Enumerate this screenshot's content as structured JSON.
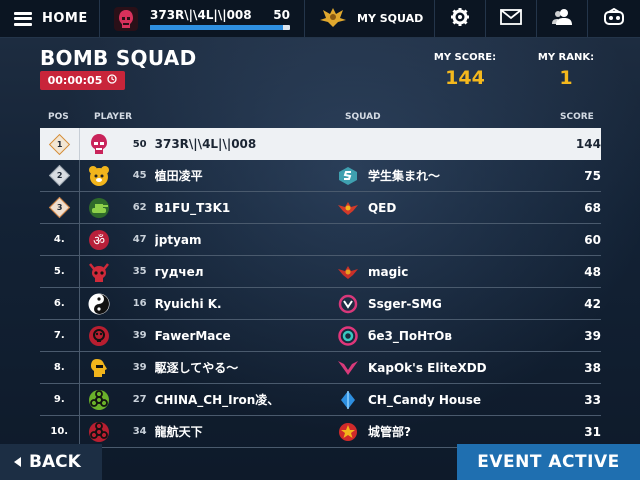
{
  "topbar": {
    "home_label": "HOME",
    "player_name": "373R\\|\\4L|\\|008",
    "player_level": "50",
    "xp_progress_percent": 95,
    "squad_label": "MY SQUAD"
  },
  "event": {
    "title": "BOMB SQUAD",
    "timer": "00:00:05"
  },
  "stats": {
    "my_score_label": "MY SCORE:",
    "my_score": "144",
    "my_rank_label": "MY RANK:",
    "my_rank": "1"
  },
  "columns": {
    "pos": "POS",
    "player": "PLAYER",
    "squad": "SQUAD",
    "score": "SCORE"
  },
  "rows": [
    {
      "pos": "1",
      "pos_style": "gold",
      "level": "50",
      "player": "373R\\|\\4L|\\|008",
      "squad": "",
      "score": "144",
      "avatar_icon": "skull-mask-icon",
      "squad_icon": ""
    },
    {
      "pos": "2",
      "pos_style": "silver",
      "level": "45",
      "player": "植田凌平",
      "squad": "学生集まれ〜",
      "score": "75",
      "avatar_icon": "bear-face-icon",
      "squad_icon": "s-shield-emblem-icon"
    },
    {
      "pos": "3",
      "pos_style": "bronze",
      "level": "62",
      "player": "B1FU_T3K1",
      "squad": "QED",
      "score": "68",
      "avatar_icon": "tank-icon",
      "squad_icon": "winged-emblem-icon"
    },
    {
      "pos": "4.",
      "pos_style": "plain",
      "level": "47",
      "player": "jptyam",
      "squad": "",
      "score": "60",
      "avatar_icon": "om-symbol-icon",
      "squad_icon": ""
    },
    {
      "pos": "5.",
      "pos_style": "plain",
      "level": "35",
      "player": "гудчел",
      "squad": "magic",
      "score": "48",
      "avatar_icon": "horned-skull-icon",
      "squad_icon": "winged-emblem-icon"
    },
    {
      "pos": "6.",
      "pos_style": "plain",
      "level": "16",
      "player": "Ryuichi K.",
      "squad": "Ssger-SMG",
      "score": "42",
      "avatar_icon": "yin-yang-icon",
      "squad_icon": "ring-emblem-icon"
    },
    {
      "pos": "7.",
      "pos_style": "plain",
      "level": "39",
      "player": "FawerMace",
      "squad": "бе3_ПоНтОв",
      "score": "39",
      "avatar_icon": "biohazard-skull-icon",
      "squad_icon": "pink-ring-emblem-icon"
    },
    {
      "pos": "8.",
      "pos_style": "plain",
      "level": "39",
      "player": "駆逐してやる〜",
      "squad": "KapOk's EliteXDD",
      "score": "38",
      "avatar_icon": "profile-head-icon",
      "squad_icon": "v-wings-emblem-icon"
    },
    {
      "pos": "9.",
      "pos_style": "plain",
      "level": "27",
      "player": "CHINA_CH_Iron凌、",
      "squad": "CH_Candy House",
      "score": "33",
      "avatar_icon": "biohazard-icon",
      "squad_icon": "blue-crystal-emblem-icon"
    },
    {
      "pos": "10.",
      "pos_style": "plain",
      "level": "34",
      "player": "龍航天下",
      "squad": "城管部?",
      "score": "31",
      "avatar_icon": "biohazard-red-icon",
      "squad_icon": "star-emblem-icon"
    }
  ],
  "footer": {
    "back_label": "BACK",
    "event_active_label": "EVENT ACTIVE"
  },
  "colors": {
    "accent_gold": "#f4b81d",
    "timer_red": "#c8253a",
    "event_blue": "#1f6fb0"
  }
}
